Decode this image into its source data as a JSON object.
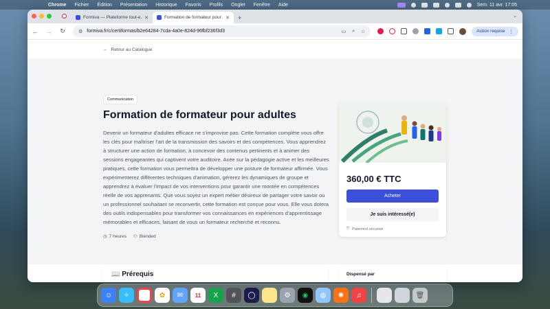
{
  "menubar": {
    "app": "Chrome",
    "items": [
      "Fichier",
      "Édition",
      "Présentation",
      "Historique",
      "Favoris",
      "Profils",
      "Onglet",
      "Fenêtre",
      "Aide"
    ],
    "clock": "Sem. 11 avr.  17:05"
  },
  "tabs": [
    {
      "title": "Formiva — Plateforme tout-e…",
      "active": false
    },
    {
      "title": "Formation de formateur pour…",
      "active": true
    }
  ],
  "toolbar": {
    "url": "formiva.fr/c/certiformas/b2e64284-7cda-4a0e-824d-96fbf236f3d3",
    "action_label": "Action requise"
  },
  "page": {
    "back_label": "Retour au Catalogue",
    "category": "Communication",
    "title": "Formation de formateur pour adultes",
    "description": "Devenir un formateur d'adultes efficace ne s'improvise pas. Cette formation complète vous offre les clés pour maîtriser l'art de la transmission des savoirs et des compétences. Vous apprendrez à structurer une action de formation, à concevoir des contenus pertinents et à animer des sessions engageantes qui captivent votre auditoire. Axée sur la pédagogie active et les meilleures pratiques, cette formation vous permettra de développer une posture de formateur affirmée. Vous expérimenterez différentes techniques d'animation, gérerez les dynamiques de groupe et apprendrez à évaluer l'impact de vos interventions pour garantir une montée en compétences réelle de vos apprenants. Que vous soyez un expert métier désireux de partager votre savoir ou un professionnel souhaitant se reconvertir, cette formation est conçue pour vous. Elle vous dotera des outils indispensables pour transformer vos connaissances en expériences d'apprentissage mémorables et efficaces, faisant de vous un formateur recherché et reconnu.",
    "duration": "7 heures",
    "modality": "Blended",
    "price": "360,00 € TTC",
    "buy_label": "Acheter",
    "interested_label": "Je suis intéressé(e)",
    "secure_label": "Paiement sécurisé",
    "prereq_heading": "Prérequis",
    "provider_heading": "Dispensé par"
  },
  "colors": {
    "accent": "#3b4fd8",
    "page_bg": "#f3f4f6"
  },
  "dock_apps": [
    "finder-icon",
    "safari-icon",
    "chrome-icon",
    "photos-icon",
    "mail-icon",
    "calendar-icon",
    "excel-icon",
    "calculator-icon",
    "app-circle-icon",
    "notes-icon",
    "settings-icon",
    "spotify-icon",
    "preview-icon",
    "perplexity-icon",
    "music-icon",
    "document-icon",
    "trash-icon"
  ]
}
